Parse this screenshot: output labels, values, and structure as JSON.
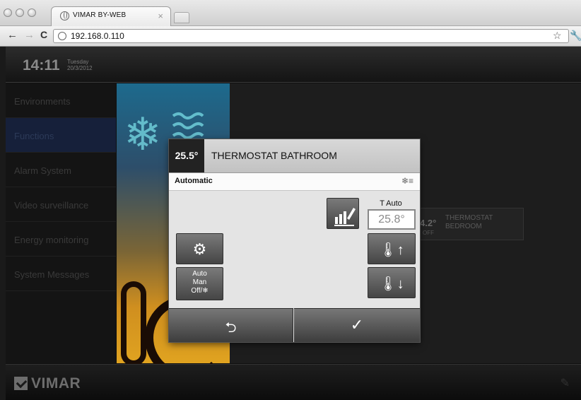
{
  "browser": {
    "tab_title": "VIMAR BY-WEB",
    "tab_close": "×",
    "back": "←",
    "forward": "→",
    "reload": "C",
    "url": "192.168.0.110",
    "star": "☆",
    "wrench": "🔧"
  },
  "header": {
    "time": "14:11",
    "day": "Tuesday",
    "date": "20/3/2012"
  },
  "sidebar": {
    "items": [
      {
        "label": "Environments"
      },
      {
        "label": "Functions"
      },
      {
        "label": "Alarm System"
      },
      {
        "label": "Video surveillance"
      },
      {
        "label": "Energy monitoring"
      },
      {
        "label": "System Messages"
      }
    ]
  },
  "background_tile": {
    "value": "4.2°",
    "status": "OFF",
    "name_line1": "THERMOSTAT",
    "name_line2": "BEDROOM"
  },
  "dialog": {
    "current_temp": "25.5°",
    "title": "THERMOSTAT BATHROOM",
    "mode": "Automatic",
    "tauto_label": "T Auto",
    "tauto_value": "25.8°",
    "mode_btn_line1": "Auto",
    "mode_btn_line2": "Man",
    "mode_btn_line3": "Off/❄",
    "back_glyph": "⮌",
    "confirm_glyph": "✓"
  },
  "footer": {
    "brand": "VIMAR"
  },
  "colors": {
    "active_sidebar": "#16203a",
    "dialog_bg": "#e4e4e4",
    "button_dark": "#454545"
  }
}
